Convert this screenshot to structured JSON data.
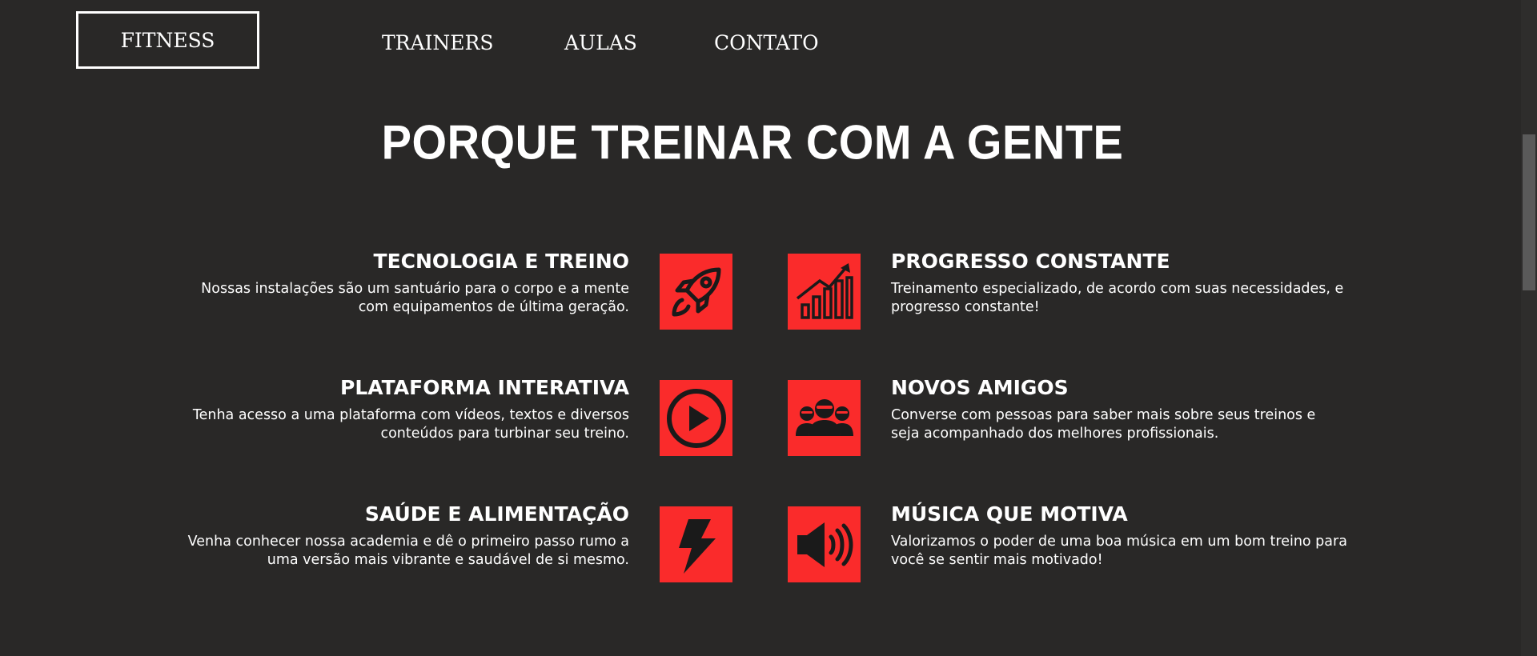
{
  "header": {
    "brand": "FITNESS",
    "nav": [
      "TRAINERS",
      "AULAS",
      "CONTATO"
    ]
  },
  "section": {
    "title": "PORQUE TREINAR COM A GENTE"
  },
  "features": [
    {
      "title": "TECNOLOGIA E TREINO",
      "desc": "Nossas instalações são um santuário para o corpo e a mente com equipamentos de última geração.",
      "icon": "rocket-icon"
    },
    {
      "title": "PROGRESSO CONSTANTE",
      "desc": "Treinamento especializado, de acordo com suas necessidades, e progresso constante!",
      "icon": "growth-chart-icon"
    },
    {
      "title": "PLATAFORMA INTERATIVA",
      "desc": "Tenha acesso a uma plataforma com vídeos, textos e diversos conteúdos para turbinar seu treino.",
      "icon": "play-icon"
    },
    {
      "title": "NOVOS AMIGOS",
      "desc": "Converse com pessoas para saber mais sobre seus treinos e seja acompanhado dos melhores profissionais.",
      "icon": "group-icon"
    },
    {
      "title": "SAÚDE E ALIMENTAÇÃO",
      "desc": "Venha conhecer nossa academia e dê o primeiro passo rumo a uma versão mais vibrante e saudável de si mesmo.",
      "icon": "lightning-icon"
    },
    {
      "title": "MÚSICA QUE MOTIVA",
      "desc": "Valorizamos o poder de uma boa música em um bom treino para você se sentir mais motivado!",
      "icon": "speaker-icon"
    }
  ],
  "colors": {
    "background": "#292827",
    "accent": "#fa2b2b",
    "text": "#ffffff"
  }
}
